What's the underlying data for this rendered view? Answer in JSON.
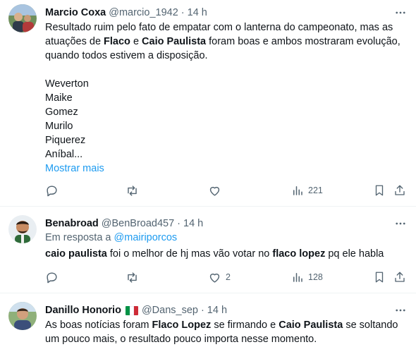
{
  "tweets": [
    {
      "name": "Marcio Coxa",
      "handle": "@marcio_1942",
      "dot": "·",
      "time": "14 h",
      "text_parts": [
        "Resultado ruim pelo fato de empatar com o lanterna do campeonato, mas as atuações de ",
        "Flaco",
        " e ",
        "Caio Paulista",
        " foram boas e ambos mostraram evolução, quando todos estivem a disposição."
      ],
      "lines": [
        "Weverton",
        "Maike",
        "Gomez",
        "Murilo",
        "Piquerez",
        "Aníbal..."
      ],
      "show_more": "Mostrar mais",
      "views": "221",
      "likes": ""
    },
    {
      "name": "Benabroad",
      "handle": "@BenBroad457",
      "dot": "·",
      "time": "14 h",
      "reply_prefix": "Em resposta a",
      "reply_handle": "@mairiporcos",
      "text_parts": [
        "caio paulista",
        " foi o melhor de hj mas vão votar no ",
        "flaco lopez",
        " pq ele habla"
      ],
      "likes": "2",
      "views": "128"
    },
    {
      "name": "Danillo Honorio",
      "flag": "Italy flag",
      "handle": "@Dans_sep",
      "dot": "·",
      "time": "14 h",
      "text_parts": [
        "As boas notícias foram ",
        "Flaco Lopez",
        " se firmando e ",
        "Caio Paulista",
        " se soltando um pouco mais, o resultado pouco importa nesse momento."
      ]
    }
  ],
  "icons": {
    "reply": "reply-icon",
    "retweet": "retweet-icon",
    "like": "heart-icon",
    "views": "views-icon",
    "bookmark": "bookmark-icon",
    "share": "share-icon",
    "more": "more-icon"
  },
  "colors": {
    "text": "#0f1419",
    "muted": "#536471",
    "link": "#1d9bf0",
    "divider": "#eff3f4"
  }
}
